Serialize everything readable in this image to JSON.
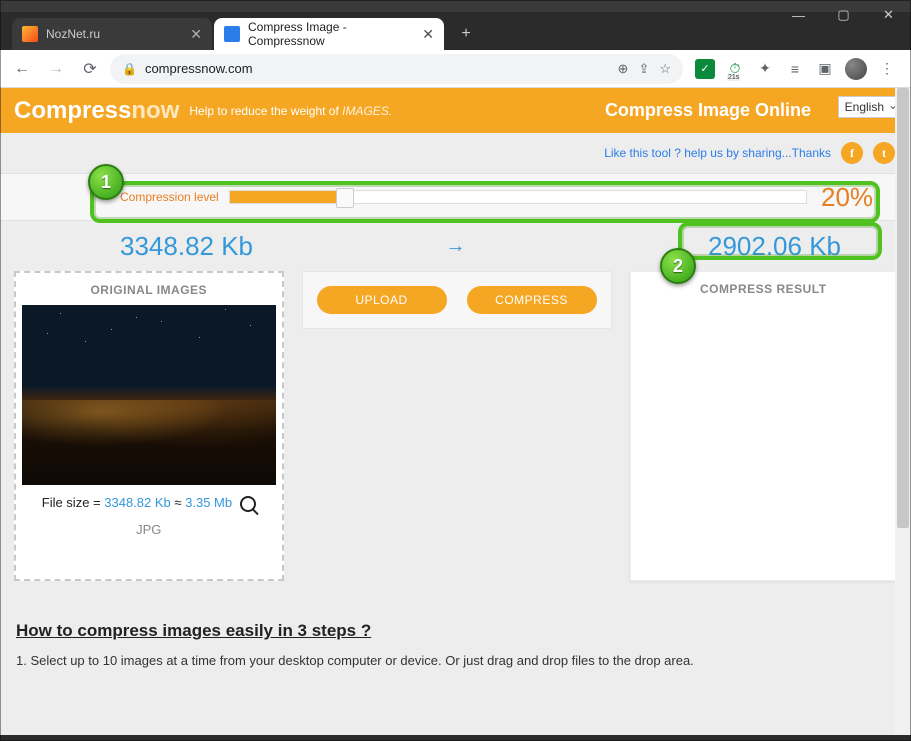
{
  "window": {
    "min": "—",
    "max": "▢",
    "close": "✕"
  },
  "tabs": [
    {
      "title": "NozNet.ru",
      "close": "✕"
    },
    {
      "title": "Compress Image - Compressnow",
      "close": "✕"
    }
  ],
  "newtab": "+",
  "nav": {
    "back": "←",
    "forward": "→",
    "reload": "⟳"
  },
  "address": {
    "lock": "🔒",
    "host": "compressnow.com"
  },
  "addr_icons": {
    "zoom": "⊕",
    "share": "⇪",
    "star": "☆"
  },
  "ext": {
    "check": "✓",
    "timer": "21s",
    "puzzle": "✦",
    "list": "≡",
    "panel": "▣",
    "menu": "⋮"
  },
  "header": {
    "logo1": "Compress",
    "logo2": "now",
    "tagline_a": "Help to reduce the weight of ",
    "tagline_b": "IMAGES.",
    "title": "Compress Image Online",
    "lang": "English"
  },
  "share": {
    "text": "Like this tool ? help us by sharing...Thanks",
    "fb": "f",
    "tw": "t"
  },
  "comp": {
    "label": "Compression level",
    "value": "20%"
  },
  "sizes": {
    "orig": "3348.82 Kb",
    "arrow": "→",
    "result": "2902.06 Kb"
  },
  "orig_panel": {
    "title": "ORIGINAL IMAGES",
    "fs_label": "File size = ",
    "fs_kb": "3348.82 Kb",
    "approx": " ≈ ",
    "fs_mb": "3.35 Mb",
    "type": "JPG"
  },
  "buttons": {
    "upload": "UPLOAD",
    "compress": "COMPRESS"
  },
  "result_panel": {
    "title": "COMPRESS RESULT"
  },
  "howto": {
    "title": "How to compress images easily in 3 steps ?",
    "step1": "1. Select up to 10 images at a time from your desktop computer or device. Or just drag and drop files to the drop area."
  },
  "anno": {
    "b1": "1",
    "b2": "2"
  }
}
